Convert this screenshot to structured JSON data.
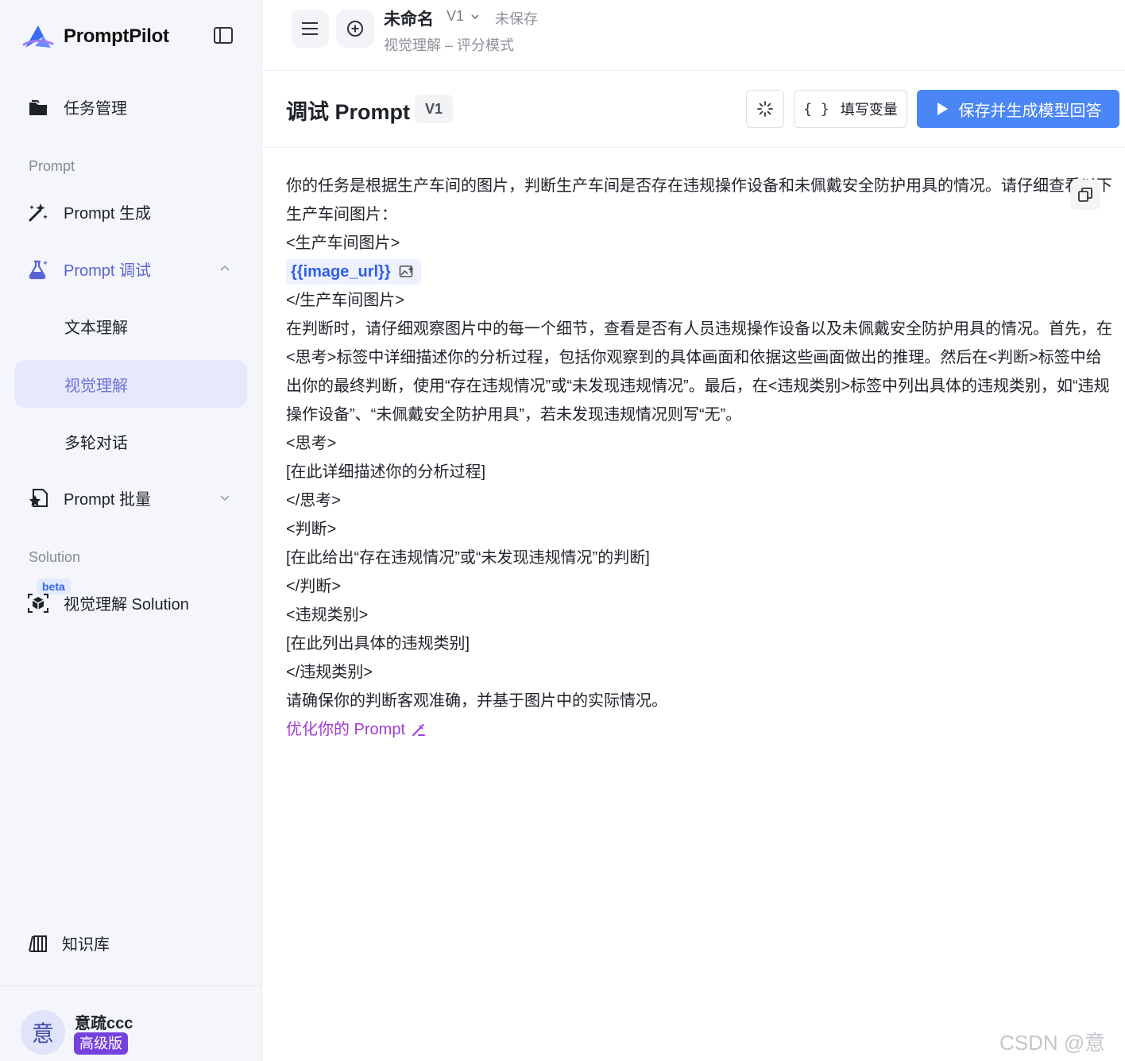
{
  "sidebar": {
    "brand": "PromptPilot",
    "task_mgmt": "任务管理",
    "section_prompt": "Prompt",
    "prompt_generate": "Prompt 生成",
    "prompt_debug": "Prompt 调试",
    "debug_children": [
      "文本理解",
      "视觉理解",
      "多轮对话"
    ],
    "prompt_batch": "Prompt 批量",
    "section_solution": "Solution",
    "beta": "beta",
    "vision_solution": "视觉理解 Solution",
    "knowledge": "知识库",
    "user": {
      "avatar_char": "意",
      "name": "意疏ccc",
      "plan": "高级版"
    }
  },
  "topbar": {
    "doc_title": "未命名",
    "version": "V1",
    "save_status": "未保存",
    "subtitle": "视觉理解 – 评分模式"
  },
  "header": {
    "title": "调试 Prompt",
    "version_badge": "V1",
    "fill_vars_braces": "{ }",
    "fill_vars": "填写变量",
    "save_generate": "保存并生成模型回答"
  },
  "prompt": {
    "line1": "你的任务是根据生产车间的图片，判断生产车间是否存在违规操作设备和未佩戴安全防护用具的情况。请仔细查看以下生产车间图片：",
    "open_tag": "<生产车间图片>",
    "variable": "{{image_url}}",
    "close_tag": "</生产车间图片>",
    "para1": "在判断时，请仔细观察图片中的每一个细节，查看是否有人员违规操作设备以及未佩戴安全防护用具的情况。首先，在<思考>标签中详细描述你的分析过程，包括你观察到的具体画面和依据这些画面做出的推理。然后在<判断>标签中给出你的最终判断，使用“存在违规情况”或“未发现违规情况”。最后，在<违规类别>标签中列出具体的违规类别，如“违规操作设备”、“未佩戴安全防护用具”，若未发现违规情况则写“无”。",
    "lines": [
      "<思考>",
      "[在此详细描述你的分析过程]",
      "</思考>",
      "<判断>",
      "[在此给出“存在违规情况”或“未发现违规情况”的判断]",
      "</判断>",
      "<违规类别>",
      "[在此列出具体的违规类别]",
      "</违规类别>",
      "请确保你的判断客观准确，并基于图片中的实际情况。"
    ],
    "optimize": "优化你的 Prompt"
  },
  "watermark": "CSDN @意疏",
  "colors": {
    "accent": "#5b62d8",
    "primary": "#4a86f5",
    "plan": "#7542e0",
    "optimize": "#a33ad9"
  }
}
